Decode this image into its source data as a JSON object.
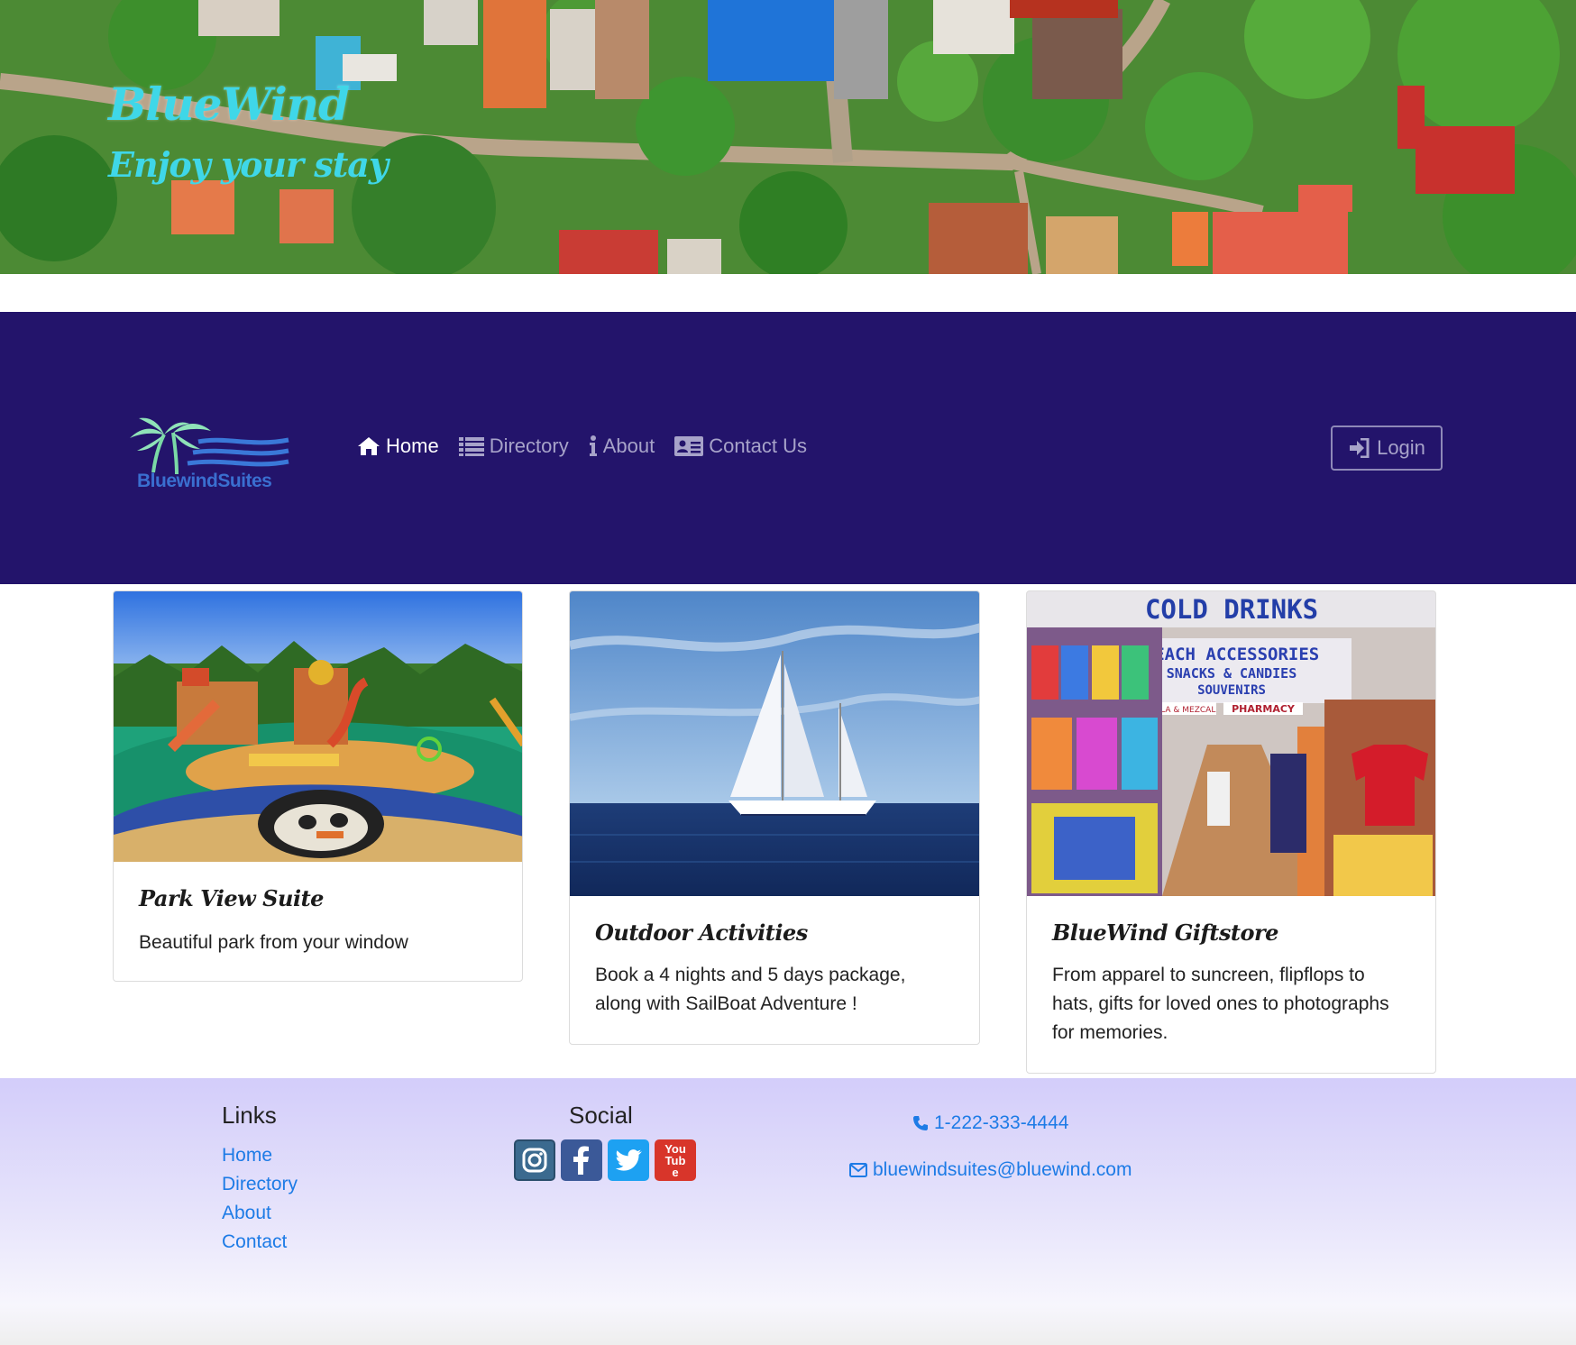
{
  "hero": {
    "title": "BlueWind",
    "tagline": "Enjoy your stay"
  },
  "navbar": {
    "logo_text": "BluewindSuites",
    "items": [
      {
        "label": "Home",
        "icon": "home-icon",
        "active": true
      },
      {
        "label": "Directory",
        "icon": "list-icon",
        "active": false
      },
      {
        "label": "About",
        "icon": "info-icon",
        "active": false
      },
      {
        "label": "Contact Us",
        "icon": "address-card-icon",
        "active": false
      }
    ],
    "login_label": "Login"
  },
  "cards": [
    {
      "title": "Park View Suite",
      "text": "Beautiful park from your window"
    },
    {
      "title": "Outdoor Activities",
      "text": "Book a 4 nights and 5 days package, along with SailBoat Adventure !"
    },
    {
      "title": "BlueWind Giftstore",
      "text": "From apparel to suncreen, flipflops to hats, gifts for loved ones to photographs for memories."
    }
  ],
  "giftstore_sign": {
    "line1": "COLD DRINKS",
    "line2": "BEACH ACCESSORIES",
    "line3": "SNACKS & CANDIES",
    "line4": "SOUVENIRS",
    "line5a": "TEQUILA & MEZCAL",
    "line5b": "PHARMACY"
  },
  "footer": {
    "links_heading": "Links",
    "links": [
      "Home",
      "Directory",
      "About",
      "Contact"
    ],
    "social_heading": "Social",
    "social": [
      "instagram-icon",
      "facebook-icon",
      "twitter-icon",
      "youtube-icon"
    ],
    "youtube_text": "You Tube",
    "phone": "1-222-333-4444",
    "email": "bluewindsuites@bluewind.com"
  },
  "colors": {
    "navbar": "#23146b",
    "accent": "#3fd7e8",
    "link": "#1d7be6",
    "footer_top": "#d3cdfa"
  }
}
